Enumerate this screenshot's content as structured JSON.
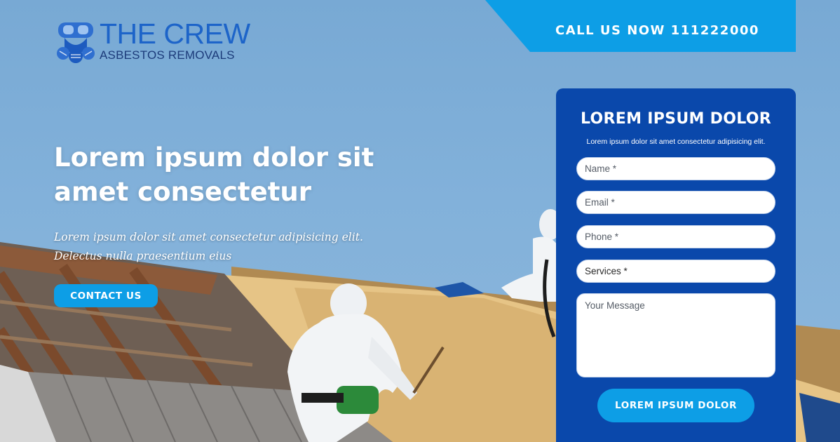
{
  "brand": {
    "title": "THE CREW",
    "subtitle": "ASBESTOS REMOVALS",
    "logo_icon": "gas-mask-icon",
    "color": "#1d64c9"
  },
  "header": {
    "call_text": "CALL US NOW 111222000",
    "banner_color": "#0d9ee6"
  },
  "hero": {
    "title": "Lorem ipsum dolor sit amet consectetur",
    "subtitle": "Lorem ipsum dolor sit amet consectetur adipisicing elit. Delectus nulla praesentium eius",
    "cta_label": "CONTACT US"
  },
  "form": {
    "title": "LOREM IPSUM DOLOR",
    "description": "Lorem ipsum dolor sit amet consectetur adipisicing elit.",
    "name_placeholder": "Name *",
    "email_placeholder": "Email *",
    "phone_placeholder": "Phone *",
    "services_value": "Services *",
    "message_placeholder": "Your Message",
    "submit_label": "LOREM IPSUM DOLOR",
    "panel_color": "#0a48ab"
  }
}
